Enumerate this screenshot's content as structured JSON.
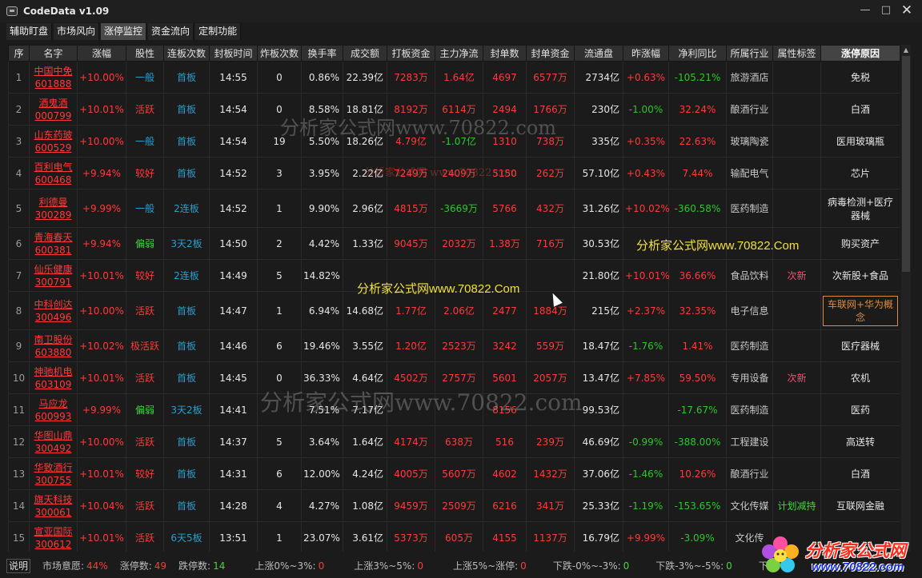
{
  "window": {
    "title": "CodeData v1.09",
    "minimize": "—",
    "maximize": "□",
    "close": "✕"
  },
  "tabs": [
    "辅助盯盘",
    "市场风向",
    "涨停监控",
    "资金流向",
    "定制功能"
  ],
  "active_tab": 2,
  "table": {
    "headers": [
      "序",
      "名字",
      "涨幅",
      "股性",
      "连板次数",
      "封板时间",
      "炸板次数",
      "换手率",
      "成交额",
      "打板资金",
      "主力净流",
      "封单数",
      "封单资金",
      "流通盘",
      "昨涨幅",
      "净利同比",
      "所属行业",
      "属性标签",
      "涨停原因"
    ],
    "rows": [
      {
        "seq": "1",
        "name": "中国中免",
        "code": "601888",
        "chg": "+10.00%",
        "trait": "一般",
        "trait_c": "blue",
        "boards": "首板",
        "time": "14:55",
        "breaks": "0",
        "turnover": "0.86%",
        "amount": "22.39亿",
        "daban": "7283万",
        "netflow": "1.64亿",
        "netflow_c": "red",
        "orders": "4697",
        "order_amt": "6577万",
        "float": "2734亿",
        "ychg": "+0.63%",
        "ychg_c": "red",
        "profit": "-105.21%",
        "profit_c": "green",
        "industry": "旅游酒店",
        "tag": "",
        "reason": "免税"
      },
      {
        "seq": "2",
        "name": "酒鬼酒",
        "code": "000799",
        "chg": "+10.01%",
        "trait": "活跃",
        "trait_c": "red",
        "boards": "首板",
        "time": "14:54",
        "breaks": "0",
        "turnover": "8.58%",
        "amount": "18.81亿",
        "daban": "8192万",
        "netflow": "6114万",
        "netflow_c": "red",
        "orders": "2494",
        "order_amt": "1766万",
        "float": "230亿",
        "ychg": "-1.00%",
        "ychg_c": "green",
        "profit": "32.24%",
        "profit_c": "red",
        "industry": "酿酒行业",
        "tag": "",
        "reason": "白酒"
      },
      {
        "seq": "3",
        "name": "山东药玻",
        "code": "600529",
        "chg": "+10.00%",
        "trait": "一般",
        "trait_c": "blue",
        "boards": "首板",
        "time": "14:54",
        "breaks": "19",
        "turnover": "5.50%",
        "amount": "18.26亿",
        "daban": "4.79亿",
        "netflow": "-1.07亿",
        "netflow_c": "green",
        "orders": "1310",
        "order_amt": "738万",
        "float": "335亿",
        "ychg": "+0.35%",
        "ychg_c": "red",
        "profit": "22.63%",
        "profit_c": "red",
        "industry": "玻璃陶瓷",
        "tag": "",
        "reason": "医用玻璃瓶"
      },
      {
        "seq": "4",
        "name": "百利电气",
        "code": "600468",
        "chg": "+9.94%",
        "trait": "较好",
        "trait_c": "red",
        "boards": "首板",
        "time": "14:52",
        "breaks": "3",
        "turnover": "3.95%",
        "amount": "2.22亿",
        "daban": "7249万",
        "netflow": "2409万",
        "netflow_c": "red",
        "orders": "5150",
        "order_amt": "262万",
        "float": "57.10亿",
        "ychg": "+0.43%",
        "ychg_c": "red",
        "profit": "7.44%",
        "profit_c": "red",
        "industry": "输配电气",
        "tag": "",
        "reason": "芯片"
      },
      {
        "seq": "5",
        "name": "利德曼",
        "code": "300289",
        "chg": "+9.99%",
        "trait": "一般",
        "trait_c": "blue",
        "boards": "2连板",
        "time": "14:52",
        "breaks": "1",
        "turnover": "9.90%",
        "amount": "2.96亿",
        "daban": "4815万",
        "netflow": "-3669万",
        "netflow_c": "green",
        "orders": "5766",
        "order_amt": "432万",
        "float": "31.26亿",
        "ychg": "+10.02%",
        "ychg_c": "red",
        "profit": "-360.58%",
        "profit_c": "green",
        "industry": "医药制造",
        "tag": "",
        "reason": "病毒检测+医疗器械"
      },
      {
        "seq": "6",
        "name": "青海春天",
        "code": "600381",
        "chg": "+9.94%",
        "trait": "偏弱",
        "trait_c": "lgreen",
        "boards": "3天2板",
        "time": "14:50",
        "breaks": "2",
        "turnover": "4.42%",
        "amount": "1.33亿",
        "daban": "9045万",
        "netflow": "2032万",
        "netflow_c": "red",
        "orders": "1.38万",
        "order_amt": "716万",
        "float": "30.53亿",
        "ychg": "",
        "ychg_c": "red",
        "profit": "",
        "profit_c": "red",
        "industry": "",
        "tag": "",
        "reason": "购买资产"
      },
      {
        "seq": "7",
        "name": "仙乐健康",
        "code": "300791",
        "chg": "+10.01%",
        "trait": "较好",
        "trait_c": "red",
        "boards": "2连板",
        "time": "14:49",
        "breaks": "5",
        "turnover": "14.82%",
        "amount": "",
        "daban": "",
        "netflow": "",
        "netflow_c": "red",
        "orders": "",
        "order_amt": "",
        "float": "21.80亿",
        "ychg": "+10.01%",
        "ychg_c": "red",
        "profit": "36.66%",
        "profit_c": "red",
        "industry": "食品饮料",
        "tag": "次新",
        "reason": "次新股+食品"
      },
      {
        "seq": "8",
        "name": "中科创达",
        "code": "300496",
        "chg": "+10.00%",
        "trait": "活跃",
        "trait_c": "red",
        "boards": "首板",
        "time": "14:47",
        "breaks": "1",
        "turnover": "6.94%",
        "amount": "14.68亿",
        "daban": "1.77亿",
        "netflow": "2.06亿",
        "netflow_c": "red",
        "orders": "2477",
        "order_amt": "1884万",
        "float": "215亿",
        "ychg": "+2.37%",
        "ychg_c": "red",
        "profit": "32.35%",
        "profit_c": "red",
        "industry": "电子信息",
        "tag": "",
        "reason": "车联网+华为概念",
        "boxed": true
      },
      {
        "seq": "9",
        "name": "南卫股份",
        "code": "603880",
        "chg": "+10.02%",
        "trait": "极活跃",
        "trait_c": "red",
        "boards": "首板",
        "time": "14:46",
        "breaks": "6",
        "turnover": "19.46%",
        "amount": "3.55亿",
        "daban": "1.20亿",
        "netflow": "2523万",
        "netflow_c": "red",
        "orders": "3242",
        "order_amt": "559万",
        "float": "18.47亿",
        "ychg": "-1.76%",
        "ychg_c": "green",
        "profit": "1.41%",
        "profit_c": "red",
        "industry": "医药制造",
        "tag": "",
        "reason": "医疗器械"
      },
      {
        "seq": "10",
        "name": "神驰机电",
        "code": "603109",
        "chg": "+10.01%",
        "trait": "活跃",
        "trait_c": "red",
        "boards": "首板",
        "time": "14:45",
        "breaks": "0",
        "turnover": "36.33%",
        "amount": "4.64亿",
        "daban": "4502万",
        "netflow": "2757万",
        "netflow_c": "red",
        "orders": "5601",
        "order_amt": "2057万",
        "float": "13.47亿",
        "ychg": "+7.85%",
        "ychg_c": "red",
        "profit": "59.50%",
        "profit_c": "red",
        "industry": "专用设备",
        "tag": "次新",
        "reason": "农机"
      },
      {
        "seq": "11",
        "name": "马应龙",
        "code": "600993",
        "chg": "+9.99%",
        "trait": "偏弱",
        "trait_c": "lgreen",
        "boards": "3天2板",
        "time": "14:41",
        "breaks": "",
        "turnover": "7.51%",
        "amount": "7.17亿",
        "daban": "",
        "netflow": "",
        "netflow_c": "red",
        "orders": "8156",
        "order_amt": "",
        "float": "99.53亿",
        "ychg": "",
        "ychg_c": "red",
        "profit": "-17.67%",
        "profit_c": "green",
        "industry": "医药制造",
        "tag": "",
        "reason": "医药"
      },
      {
        "seq": "12",
        "name": "华图山鼎",
        "code": "300492",
        "chg": "+10.00%",
        "trait": "活跃",
        "trait_c": "red",
        "boards": "首板",
        "time": "14:37",
        "breaks": "5",
        "turnover": "3.64%",
        "amount": "1.64亿",
        "daban": "4174万",
        "netflow": "638万",
        "netflow_c": "red",
        "orders": "516",
        "order_amt": "239万",
        "float": "46.69亿",
        "ychg": "-0.99%",
        "ychg_c": "green",
        "profit": "-388.00%",
        "profit_c": "green",
        "industry": "工程建设",
        "tag": "",
        "reason": "高送转"
      },
      {
        "seq": "13",
        "name": "华致酒行",
        "code": "300755",
        "chg": "+10.01%",
        "trait": "较好",
        "trait_c": "red",
        "boards": "首板",
        "time": "14:31",
        "breaks": "6",
        "turnover": "12.00%",
        "amount": "4.24亿",
        "daban": "4005万",
        "netflow": "5607万",
        "netflow_c": "red",
        "orders": "4602",
        "order_amt": "1432万",
        "float": "37.06亿",
        "ychg": "-1.46%",
        "ychg_c": "green",
        "profit": "10.26%",
        "profit_c": "red",
        "industry": "酿酒行业",
        "tag": "",
        "reason": "白酒"
      },
      {
        "seq": "14",
        "name": "旗天科技",
        "code": "300061",
        "chg": "+10.04%",
        "trait": "活跃",
        "trait_c": "red",
        "boards": "首板",
        "time": "14:28",
        "breaks": "4",
        "turnover": "4.27%",
        "amount": "1.08亿",
        "daban": "9459万",
        "netflow": "2509万",
        "netflow_c": "red",
        "orders": "6216",
        "order_amt": "341万",
        "float": "25.33亿",
        "ychg": "-1.19%",
        "ychg_c": "green",
        "profit": "-153.65%",
        "profit_c": "green",
        "industry": "文化传媒",
        "tag": "计划减持",
        "tag_c": "lgreen",
        "reason": "互联网金融"
      },
      {
        "seq": "15",
        "name": "宣亚国际",
        "code": "300612",
        "chg": "+10.01%",
        "trait": "活跃",
        "trait_c": "red",
        "boards": "6天5板",
        "time": "13:51",
        "breaks": "1",
        "turnover": "23.07%",
        "amount": "3.61亿",
        "daban": "5373万",
        "netflow": "605万",
        "netflow_c": "red",
        "orders": "4155",
        "order_amt": "1137万",
        "float": "16.79亿",
        "ychg": "+9.99%",
        "ychg_c": "red",
        "profit": "-3.09%",
        "profit_c": "green",
        "industry": "文化传",
        "tag": "",
        "reason": ""
      }
    ]
  },
  "status": {
    "help": "说明",
    "sentiment_label": "市场意愿:",
    "sentiment_value": "44%",
    "limit_up_label": "涨停数:",
    "limit_up_value": "49",
    "limit_down_label": "跌停数:",
    "limit_down_value": "14",
    "r1_label": "上涨0%~3%:",
    "r1_value": "0",
    "r2_label": "上涨3%~5%:",
    "r2_value": "0",
    "r3_label": "上涨5%~涨停:",
    "r3_value": "0",
    "d1_label": "下跌-0%~-3%:",
    "d1_value": "0",
    "d2_label": "下跌-3%~-5%:",
    "d2_value": "0",
    "d3_label": "下跌"
  },
  "watermarks": {
    "w1": "分析家公式网www.70822.com",
    "w2": "分析家公式网 www.70822.com",
    "w3": "分析家公式网www.70822.com",
    "wy1": "分析家公式网www.70822.Com",
    "wy2": "分析家公式网www.70822.Com"
  },
  "logo": {
    "text": "分析家公式网",
    "url": "www.70822.com"
  }
}
